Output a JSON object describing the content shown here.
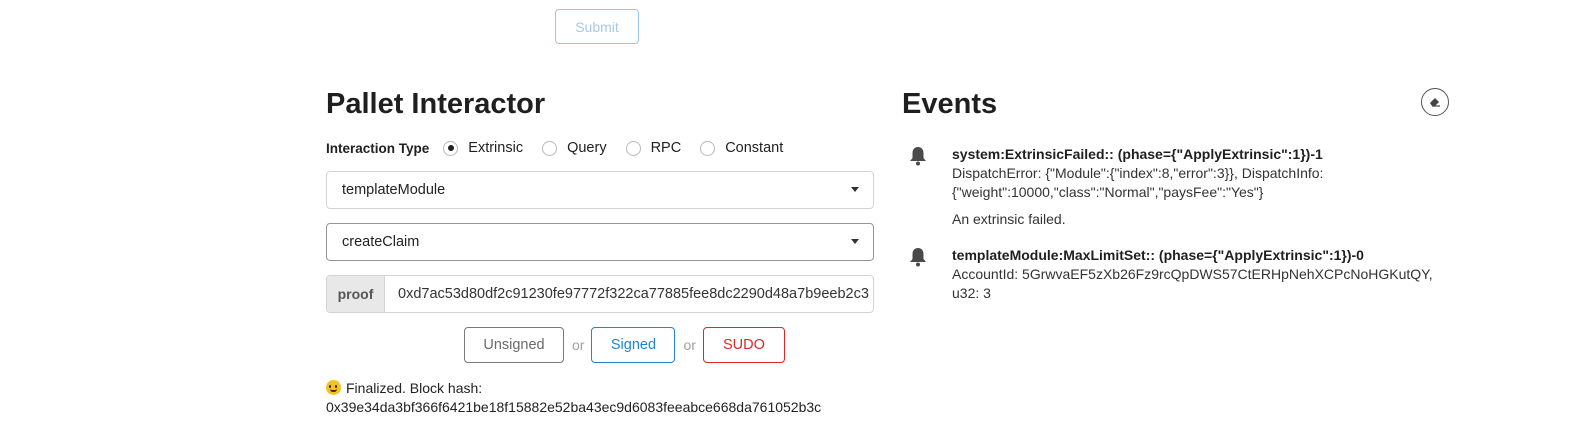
{
  "top": {
    "submit_label": "Submit"
  },
  "interactor": {
    "title": "Pallet Interactor",
    "interaction_type_label": "Interaction Type",
    "types": [
      {
        "label": "Extrinsic",
        "checked": true
      },
      {
        "label": "Query",
        "checked": false
      },
      {
        "label": "RPC",
        "checked": false
      },
      {
        "label": "Constant",
        "checked": false
      }
    ],
    "pallet_selected": "templateModule",
    "callable_selected": "createClaim",
    "proof_label": "proof",
    "proof_value": "0xd7ac53d80df2c91230fe97772f322ca77885fee8dc2290d48a7b9eeb2c3",
    "buttons": {
      "unsigned": "Unsigned",
      "or": "or",
      "signed": "Signed",
      "sudo": "SUDO"
    },
    "status_line1": "Finalized. Block hash:",
    "status_line2": "0x39e34da3bf366f6421be18f15882e52ba43ec9d6083feeabce668da761052b3c"
  },
  "events": {
    "title": "Events",
    "clear_icon": "eraser-icon",
    "items": [
      {
        "icon": "bell-icon",
        "head": "system:ExtrinsicFailed:: (phase={\"ApplyExtrinsic\":1})-1",
        "detail_line1": "DispatchError: {\"Module\":{\"index\":8,\"error\":3}}, DispatchInfo:",
        "detail_line2": "{\"weight\":10000,\"class\":\"Normal\",\"paysFee\":\"Yes\"}",
        "desc": "An extrinsic failed."
      },
      {
        "icon": "bell-icon",
        "head": "templateModule:MaxLimitSet:: (phase={\"ApplyExtrinsic\":1})-0",
        "detail_line1": "AccountId: 5GrwvaEF5zXb26Fz9rcQpDWS57CtERHpNehXCPcNoHGKutQY,",
        "detail_line2": "u32: 3"
      }
    ]
  }
}
